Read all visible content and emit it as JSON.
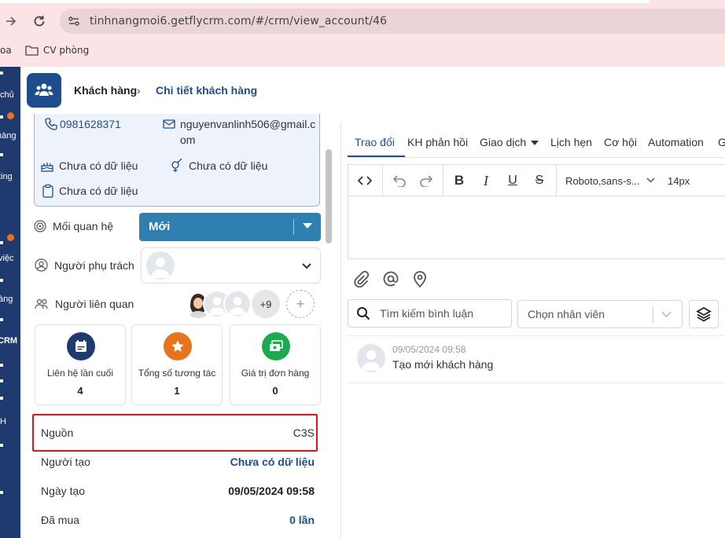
{
  "browser": {
    "url": "tinhnangmoi6.getflycrm.com/#/crm/view_account/46",
    "bookmarks": [
      {
        "label": "oa"
      },
      {
        "label": "CV phòng"
      }
    ]
  },
  "sidebar": {
    "items": [
      {
        "label": "chủ"
      },
      {
        "label": "hàng"
      },
      {
        "label": "ting"
      },
      {
        "label": "việc"
      },
      {
        "label": "àng"
      },
      {
        "label": "CRM"
      },
      {
        "label": "H"
      }
    ]
  },
  "header": {
    "breadcrumb_root": "Khách hàng",
    "breadcrumb_sep": "›",
    "breadcrumb_current": "Chi tiết khách hàng"
  },
  "contact": {
    "phone": "0981628371",
    "email_line1": "nguyenvanlinh506@gmail.c",
    "email_line2": "om",
    "birthday": "Chưa có dữ liệu",
    "gender": "Chưa có dữ liệu",
    "document": "Chưa có dữ liệu"
  },
  "relationship": {
    "label": "Mối quan hệ",
    "value": "Mới"
  },
  "owner": {
    "label": "Người phụ trách"
  },
  "related": {
    "label": "Người liên quan",
    "more": "+9",
    "add": "+"
  },
  "stats": [
    {
      "label": "Liên hệ lần cuối",
      "value": "4",
      "color": "#1e3a6e",
      "icon": "calendar-icon"
    },
    {
      "label": "Tổng số tương tác",
      "value": "1",
      "color": "#e8731f",
      "icon": "star-icon"
    },
    {
      "label": "Giá trị đơn hàng",
      "value": "0",
      "color": "#1ea94f",
      "icon": "money-icon"
    }
  ],
  "info": [
    {
      "key": "Nguồn",
      "value": "C3S",
      "color": "#333333"
    },
    {
      "key": "Người tạo",
      "value": "Chưa có dữ liệu",
      "color": "#1e4d8c"
    },
    {
      "key": "Ngày tạo",
      "value": "09/05/2024 09:58",
      "color": "#222222"
    },
    {
      "key": "Đã mua",
      "value": "0 lần",
      "color": "#1e4d8c"
    }
  ],
  "tabs": [
    {
      "label": "Trao đổi",
      "active": true
    },
    {
      "label": "KH phản hồi"
    },
    {
      "label": "Giao dịch"
    },
    {
      "label": "Lịch hẹn"
    },
    {
      "label": "Cơ hội"
    },
    {
      "label": "Automation"
    },
    {
      "label": "G"
    }
  ],
  "editor": {
    "font_family": "Roboto,sans-s...",
    "font_size": "14px"
  },
  "comments_filter": {
    "search_placeholder": "Tìm kiếm bình luận",
    "employee_placeholder": "Chọn nhân viên"
  },
  "comments": [
    {
      "time": "09/05/2024 09:58",
      "text": "Tạo mới khách hàng"
    }
  ],
  "colors": {
    "brand": "#1e4d8c",
    "sidebar": "#1e3a6e",
    "relationship": "#2f7fb0",
    "highlight": "#e0141e"
  }
}
